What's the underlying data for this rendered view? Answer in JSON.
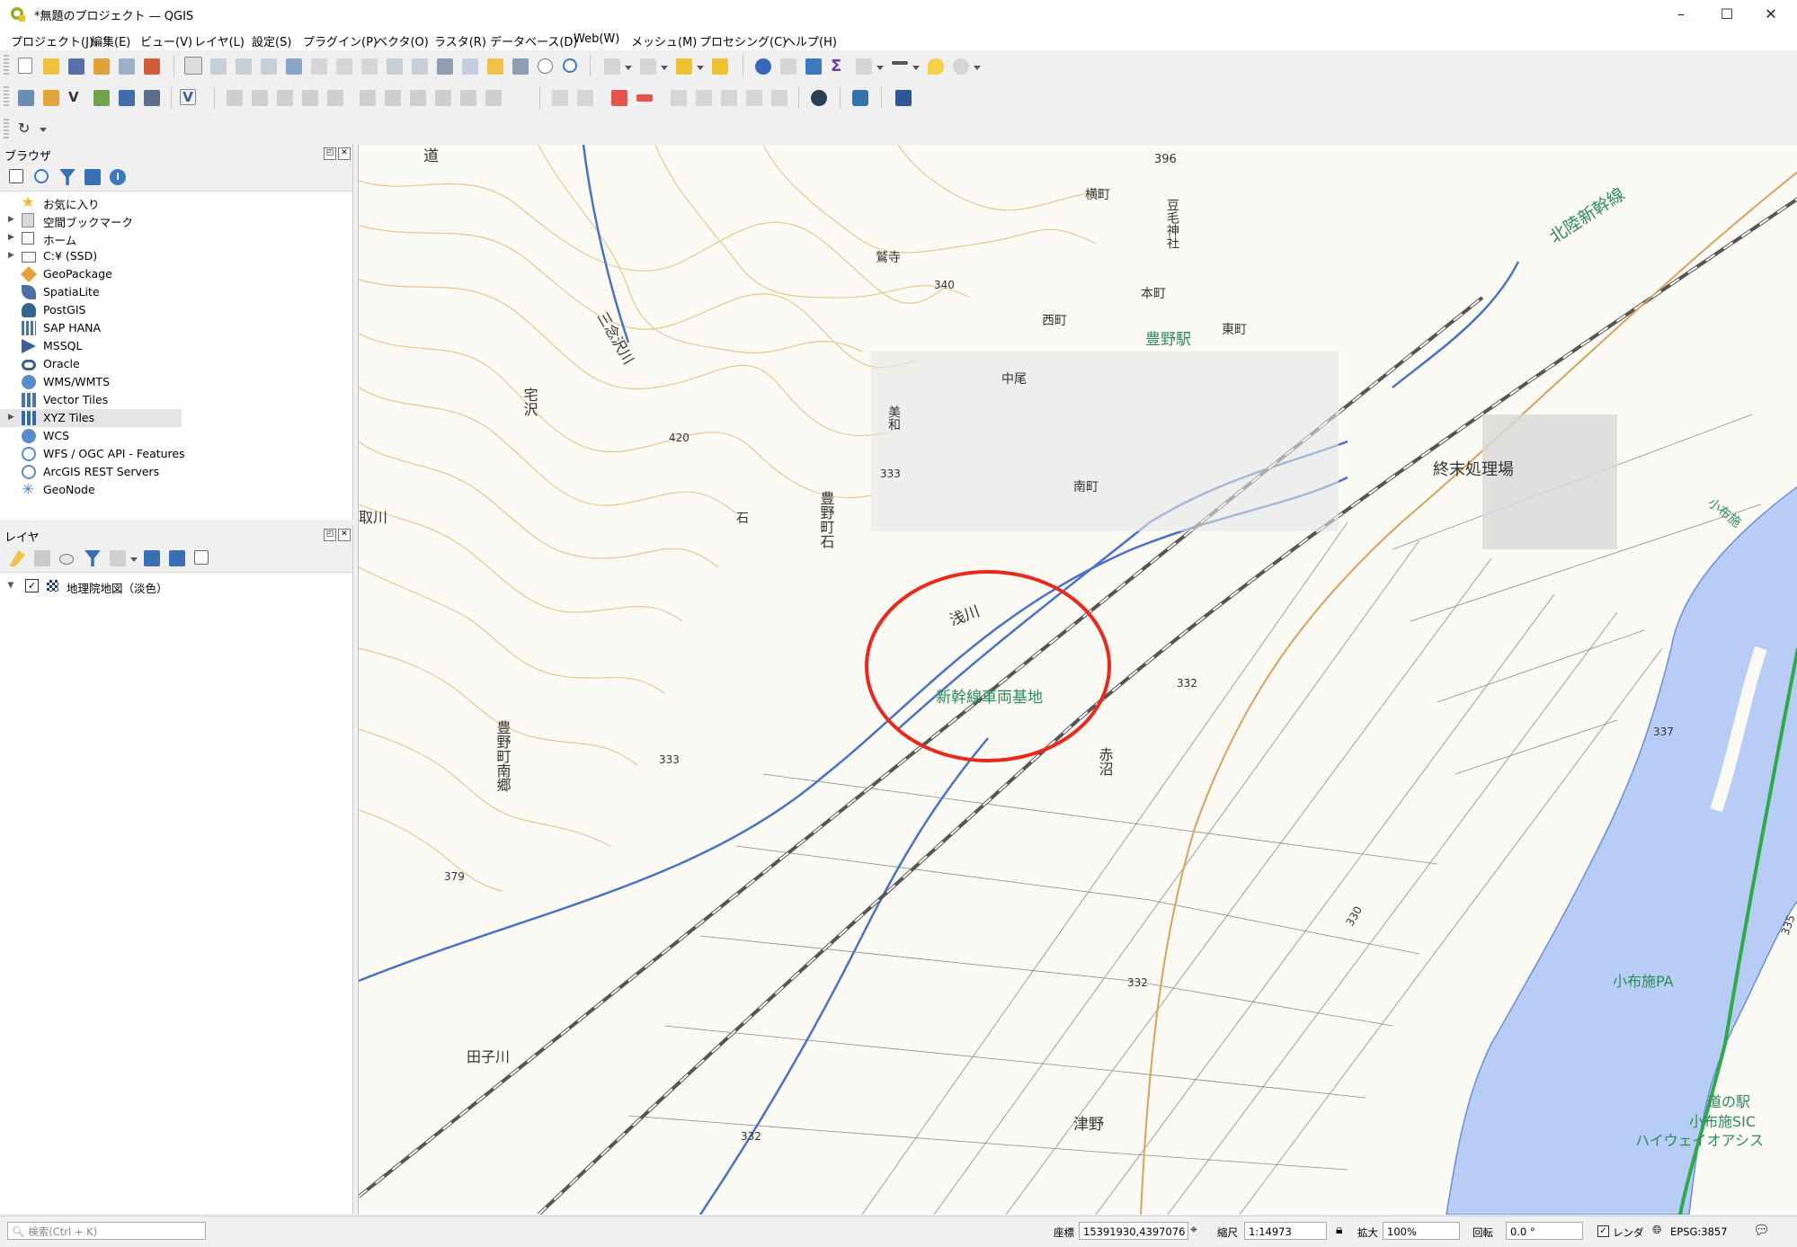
{
  "window": {
    "title": "*無題のプロジェクト — QGIS"
  },
  "menu": [
    "プロジェクト(J)",
    "編集(E)",
    "ビュー(V)",
    "レイヤ(L)",
    "設定(S)",
    "プラグイン(P)",
    "ベクタ(O)",
    "ラスタ(R)",
    "データベース(D)",
    "Web(W)",
    "メッシュ(M)",
    "プロセシング(C)",
    "ヘルプ(H)"
  ],
  "browser": {
    "title": "ブラウザ",
    "items": [
      {
        "label": "お気に入り",
        "icon": "star-icon",
        "expand": false
      },
      {
        "label": "空間ブックマーク",
        "icon": "bookmark-icon",
        "expand": true
      },
      {
        "label": "ホーム",
        "icon": "home-folder-icon",
        "expand": true
      },
      {
        "label": "C:¥ (SSD)",
        "icon": "drive-icon",
        "expand": true
      },
      {
        "label": "GeoPackage",
        "icon": "geopackage-icon",
        "expand": false
      },
      {
        "label": "SpatiaLite",
        "icon": "spatialite-icon",
        "expand": false
      },
      {
        "label": "PostGIS",
        "icon": "postgis-icon",
        "expand": false
      },
      {
        "label": "SAP HANA",
        "icon": "sap-hana-icon",
        "expand": false
      },
      {
        "label": "MSSQL",
        "icon": "mssql-icon",
        "expand": false
      },
      {
        "label": "Oracle",
        "icon": "oracle-icon",
        "expand": false
      },
      {
        "label": "WMS/WMTS",
        "icon": "globe-icon",
        "expand": false
      },
      {
        "label": "Vector Tiles",
        "icon": "vector-tiles-icon",
        "expand": false
      },
      {
        "label": "XYZ Tiles",
        "icon": "xyz-tiles-icon",
        "expand": true
      },
      {
        "label": "WCS",
        "icon": "globe-icon",
        "expand": false
      },
      {
        "label": "WFS / OGC API - Features",
        "icon": "wfs-icon",
        "expand": false
      },
      {
        "label": "ArcGIS REST Servers",
        "icon": "arcgis-icon",
        "expand": false
      },
      {
        "label": "GeoNode",
        "icon": "geonode-icon",
        "expand": false
      }
    ]
  },
  "layers": {
    "title": "レイヤ",
    "items": [
      {
        "label": "地理院地図（淡色）",
        "checked": true
      }
    ]
  },
  "map": {
    "labels": [
      "道",
      "豆毛神社",
      "横町",
      "北陸新幹線",
      "鷲寺",
      "340",
      "西町",
      "本町",
      "豊野駅",
      "東町",
      "中尾",
      "美和",
      "三念沢川",
      "宅沢",
      "420",
      "333",
      "終末処理場",
      "取川",
      "南町",
      "豊野町石",
      "石",
      "浅川",
      "新幹線車両基地",
      "332",
      "赤沼",
      "337",
      "小布施",
      "豊野町南郷",
      "333",
      "379",
      "332",
      "小布施PA",
      "道の駅",
      "小布施SIC",
      "ハイウェイオアシス",
      "田子川",
      "津野",
      "332",
      "330",
      "396",
      "335"
    ],
    "annotation_color": "#e8291c"
  },
  "status": {
    "search_placeholder": "検索(Ctrl + K)",
    "coord_label": "座標",
    "coord_value": "15391930,4397076",
    "scale_label": "縮尺",
    "scale_value": "1:14973",
    "magnifier_label": "拡大",
    "magnifier_value": "100%",
    "rotation_label": "回転",
    "rotation_value": "0.0 °",
    "render_label": "レンダ",
    "crs": "EPSG:3857"
  }
}
